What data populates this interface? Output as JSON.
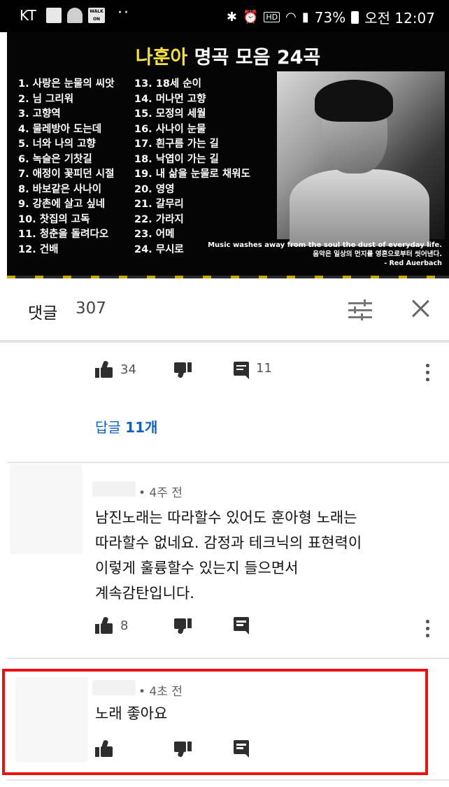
{
  "status_bar": {
    "carrier": "KT",
    "walk_icon_label": "WALK ON",
    "dots": "··",
    "bluetooth": "✱",
    "hd": "HD",
    "battery": "73%",
    "time": "오전 12:07"
  },
  "video": {
    "title_artist": "나훈아",
    "title_rest": " 명곡 모음 24곡",
    "tracks_left": [
      "1. 사랑은 눈물의 씨앗",
      "2. 님 그리워",
      "3. 고향역",
      "4. 물레방아 도는데",
      "5. 너와 나의 고향",
      "6. 녹슬은 기찻길",
      "7. 애정이 꽃피던 시절",
      "8. 바보같은 사나이",
      "9. 강촌에 살고 싶네",
      "10. 찻집의 고독",
      "11. 청춘을 돌려다오",
      "12. 건배"
    ],
    "tracks_right": [
      "13. 18세 순이",
      "14. 머나먼 고향",
      "15. 모정의 세월",
      "16. 사나이 눈물",
      "17. 흰구름 가는 길",
      "18. 낙엽이 가는 길",
      "19. 내 삶을 눈물로 채워도",
      "20. 영영",
      "21. 갈무리",
      "22. 가라지",
      "23. 어메",
      "24. 무시로"
    ],
    "quote_en": "Music washes away from the soul the dust of everyday life.",
    "quote_ko": "음악은 일상의 먼지를 영혼으로부터 씻어낸다.",
    "quote_author": "- Red Auerbach",
    "accent_color": "#f6e03a"
  },
  "comments_header": {
    "title": "댓글",
    "count": "307"
  },
  "pinned_actions": {
    "likes": "34",
    "replies": "11"
  },
  "view_replies": {
    "prefix": "답글 ",
    "count": "11개"
  },
  "comments": [
    {
      "time": "• 4주 전",
      "text": "남진노래는 따라할수 있어도 훈아형  노래는\n따라할수 없네요.  감정과 테크닉의  표현력이\n이렇게 훌륭할수 있는지 들으면서\n계속감탄입니다.",
      "likes": "8"
    },
    {
      "time": "• 4초 전",
      "text": "노래 좋아요",
      "likes": ""
    }
  ],
  "colors": {
    "highlight": "#e81212",
    "link": "#0b63c4"
  }
}
